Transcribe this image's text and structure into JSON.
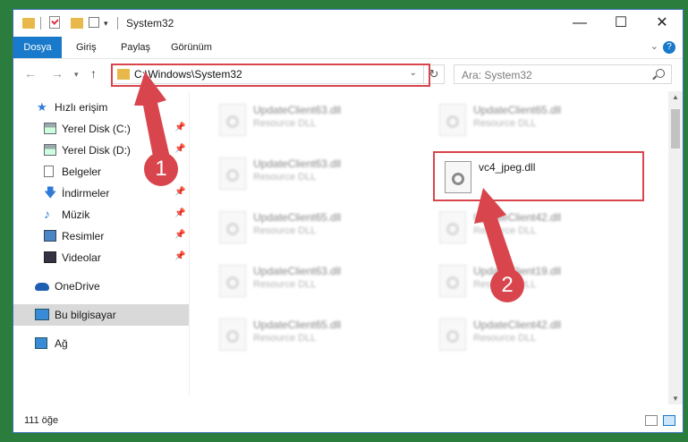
{
  "window": {
    "title": "System32",
    "controls": {
      "minimize": "—",
      "maximize": "☐",
      "close": "✕"
    }
  },
  "ribbon": {
    "tabs": [
      "Dosya",
      "Giriş",
      "Paylaş",
      "Görünüm"
    ]
  },
  "navigation": {
    "address": "C:\\Windows\\System32",
    "search_placeholder": "Ara: System32"
  },
  "sidebar": {
    "items": [
      {
        "label": "Hızlı erişim",
        "icon": "star-icon"
      },
      {
        "label": "Yerel Disk (C:)",
        "icon": "disk-icon"
      },
      {
        "label": "Yerel Disk (D:)",
        "icon": "disk-icon"
      },
      {
        "label": "Belgeler",
        "icon": "document-icon"
      },
      {
        "label": "İndirmeler",
        "icon": "download-icon"
      },
      {
        "label": "Müzik",
        "icon": "music-icon"
      },
      {
        "label": "Resimler",
        "icon": "pictures-icon"
      },
      {
        "label": "Videolar",
        "icon": "video-icon"
      },
      {
        "label": "OneDrive",
        "icon": "cloud-icon"
      },
      {
        "label": "Bu bilgisayar",
        "icon": "computer-icon"
      },
      {
        "label": "Ağ",
        "icon": "network-icon"
      }
    ]
  },
  "files": {
    "left_column": [
      {
        "name": "UpdateClient63.dll",
        "type": "Resource DLL"
      },
      {
        "name": "UpdateClient63.dll",
        "type": "Resource DLL"
      },
      {
        "name": "UpdateClient65.dll",
        "type": "Resource DLL"
      },
      {
        "name": "UpdateClient63.dll",
        "type": "Resource DLL"
      },
      {
        "name": "UpdateClient65.dll",
        "type": "Resource DLL"
      }
    ],
    "right_column": [
      {
        "name": "UpdateClient65.dll",
        "type": "Resource DLL"
      },
      {
        "name": "vc4_jpeg.dll",
        "type": ""
      },
      {
        "name": "UpdateClient42.dll",
        "type": "Resource DLL"
      },
      {
        "name": "UpdateClient19.dll",
        "type": "Resource DLL"
      },
      {
        "name": "UpdateClient42.dll",
        "type": "Resource DLL"
      }
    ]
  },
  "status": {
    "item_count": "111 öğe"
  },
  "annotations": {
    "step1": "1",
    "step2": "2",
    "color": "#d9454d"
  }
}
